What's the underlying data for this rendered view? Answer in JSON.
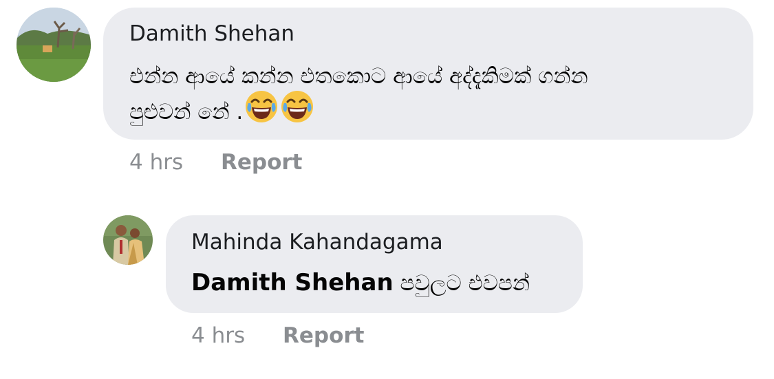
{
  "comments": [
    {
      "author": "Damith Shehan",
      "line1": "එන්න ආයේ කන්න එතකොට ආයේ අද්දැකිමක් ගන්න",
      "line2": "පුළුවන් නේ .",
      "emoji": [
        "laughing-tears-emoji",
        "laughing-tears-emoji"
      ],
      "time": "4 hrs",
      "report_label": "Report"
    }
  ],
  "reply": {
    "author": "Mahinda Kahandagama",
    "mention": "Damith Shehan",
    "text": "පවුලට එවපන්",
    "time": "4 hrs",
    "report_label": "Report"
  },
  "colors": {
    "bubble_bg": "#ebecf0",
    "meta_text": "#8a8d91",
    "body_text": "#050505"
  }
}
